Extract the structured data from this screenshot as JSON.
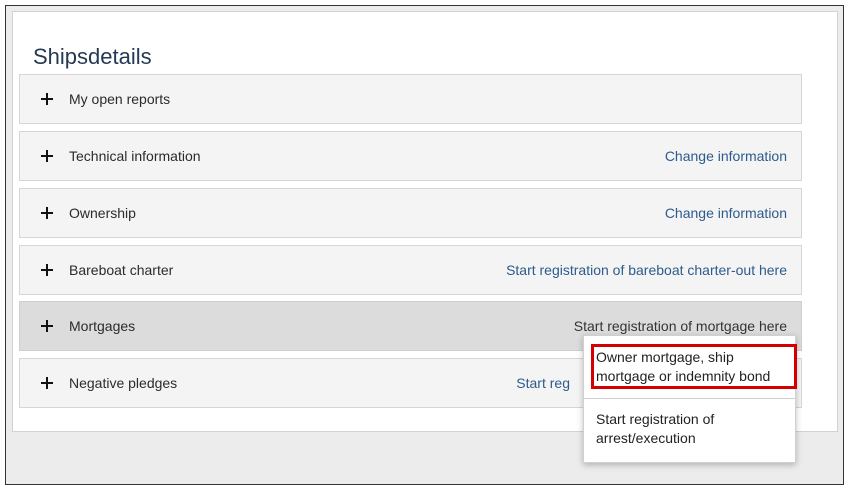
{
  "page": {
    "title": "Shipsdetails"
  },
  "rows": [
    {
      "label": "My open reports",
      "action": ""
    },
    {
      "label": "Technical information",
      "action": "Change information"
    },
    {
      "label": "Ownership",
      "action": "Change information"
    },
    {
      "label": "Bareboat charter",
      "action": "Start registration of bareboat charter-out here"
    },
    {
      "label": "Mortgages",
      "action": "Start registration of mortgage here"
    },
    {
      "label": "Negative pledges",
      "action": "Start reg"
    }
  ],
  "dropdown": {
    "items": [
      {
        "label": "Owner mortgage, ship mortgage or indemnity bond"
      },
      {
        "label": "Start registration of arrest/execution"
      }
    ]
  },
  "colors": {
    "link": "#2d5b8c",
    "title": "#253a52",
    "highlight": "#d40000"
  },
  "icons": {
    "expand": "plus-icon"
  }
}
